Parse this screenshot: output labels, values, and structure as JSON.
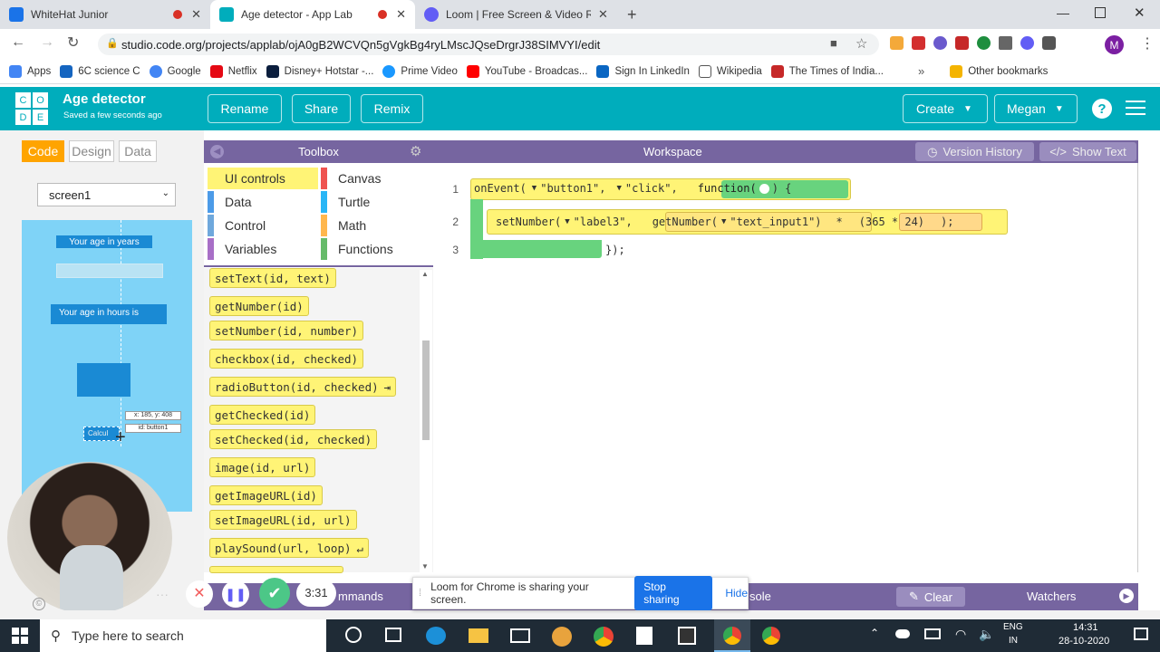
{
  "browser": {
    "tabs": [
      {
        "title": "WhiteHat Junior",
        "fav_color": "#1a73e8"
      },
      {
        "title": "Age detector - App Lab",
        "fav_color": "#00adbc"
      },
      {
        "title": "Loom | Free Screen & Video Rec",
        "fav_color": "#625df5"
      }
    ],
    "new_tab": "+",
    "url": "studio.code.org/projects/applab/ojA0gB2WCVQn5gVgkBg4ryLMscJQseDrgrJ38SIMVYI/edit",
    "bookmarks": [
      "Apps",
      "6C science C",
      "Google",
      "Netflix",
      "Disney+ Hotstar -...",
      "Prime Video",
      "YouTube - Broadcas...",
      "Sign In LinkedIn",
      "Wikipedia",
      "The Times of India...",
      "Other bookmarks"
    ],
    "bookmark_colors": [
      "#4285f4",
      "#1565c0",
      "#1a73e8",
      "#4285f4",
      "#e50914",
      "#0b1e3d",
      "#1a98ff",
      "#ff0000",
      "#0a66c2",
      "#555555",
      "#c62828",
      "#f4b400"
    ],
    "overflow": "»",
    "avatar": "M"
  },
  "app": {
    "logo_letters": [
      "C",
      "O",
      "D",
      "E"
    ],
    "title": "Age detector",
    "saved": "Saved a few seconds ago",
    "buttons": {
      "rename": "Rename",
      "share": "Share",
      "remix": "Remix",
      "create": "Create",
      "user": "Megan"
    },
    "help": "?",
    "accent": "#00adbc"
  },
  "left": {
    "tabs": [
      "Code",
      "Design",
      "Data"
    ],
    "screen": "screen1",
    "preview": {
      "label1": "Your age in years",
      "label2": "Your age in hours is",
      "tooltip_pos": "x: 185, y: 408",
      "tooltip_id": "id: button1",
      "button_text": "Calcul"
    }
  },
  "toolbox": {
    "title": "Toolbox",
    "categories_left": [
      {
        "name": "UI controls",
        "color": "#fff476"
      },
      {
        "name": "Data",
        "color": "#4c9be8"
      },
      {
        "name": "Control",
        "color": "#6fa8dc"
      },
      {
        "name": "Variables",
        "color": "#a86fc7"
      }
    ],
    "categories_right": [
      {
        "name": "Canvas",
        "color": "#ef5350"
      },
      {
        "name": "Turtle",
        "color": "#29b6f6"
      },
      {
        "name": "Math",
        "color": "#ffb74d"
      },
      {
        "name": "Functions",
        "color": "#66bb6a"
      }
    ],
    "blocks": [
      "setText(id, text)",
      "getNumber(id)",
      "setNumber(id, number)",
      "checkbox(id, checked)",
      "radioButton(id, checked)",
      "getChecked(id)",
      "setChecked(id, checked)",
      "image(id, url)",
      "getImageURL(id)",
      "setImageURL(id, url)",
      "playSound(url, loop)"
    ]
  },
  "workspace": {
    "title": "Workspace",
    "version_history": "Version History",
    "show_text": "Show Text",
    "line_numbers": [
      "1",
      "2",
      "3"
    ],
    "line1": {
      "fn": "onEvent(",
      "arg1": "\"button1\",",
      "arg2": "\"click\",",
      "func": "function(",
      "close": ") {"
    },
    "line2": {
      "fn": "setNumber(",
      "arg1": "\"label3\",",
      "inner_fn": "getNumber(",
      "inner_arg": "\"text_input1\"",
      "op": "*",
      "math": "(365 * 24)",
      "end": ");"
    },
    "line3": {
      "end": "});"
    }
  },
  "bottom": {
    "commands": "mmands",
    "console": "sole",
    "clear": "Clear",
    "watchers": "Watchers"
  },
  "loom": {
    "message": "Loom for Chrome is sharing your screen.",
    "stop": "Stop sharing",
    "hide": "Hide",
    "timer": "3:31"
  },
  "taskbar": {
    "search": "Type here to search",
    "lang1": "ENG",
    "lang2": "IN",
    "time": "14:31",
    "date": "28-10-2020"
  }
}
